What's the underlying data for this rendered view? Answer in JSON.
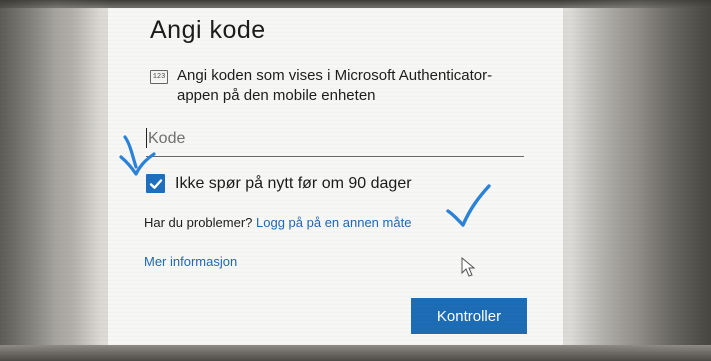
{
  "dialog": {
    "title": "Angi kode",
    "instruction_icon": "numeric-code-icon",
    "instruction_icon_text": "123",
    "instruction_text": "Angi koden som vises i Microsoft Authenticator-appen på den mobile enheten",
    "code_field": {
      "placeholder": "Kode",
      "value": ""
    },
    "remember_checkbox": {
      "label": "Ikke spør på nytt før om 90 dager",
      "checked": true
    },
    "problem_text": "Har du problemer?",
    "alt_signin_link": "Logg på på en annen måte",
    "more_info_link": "Mer informasjon",
    "verify_button": "Kontroller"
  },
  "colors": {
    "accent": "#1f6fbf",
    "link": "#1f68b8",
    "annotation": "#2b83d9"
  },
  "annotations": [
    "blue-check-arrow-near-checkbox",
    "blue-check-arrow-near-link"
  ]
}
